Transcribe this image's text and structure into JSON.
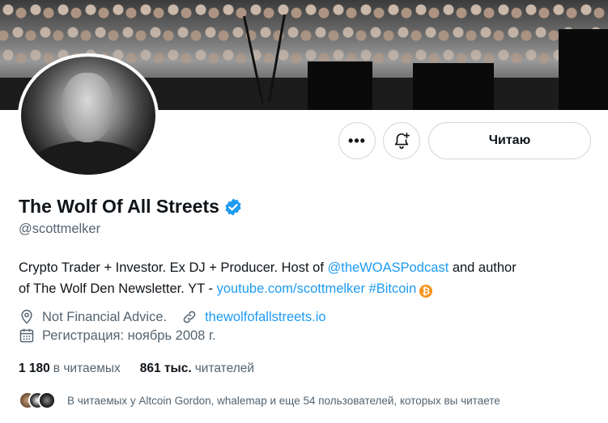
{
  "profile": {
    "name": "The Wolf Of All Streets",
    "handle": "@scottmelker",
    "follow_button_label": "Читаю",
    "verified_icon": "verified-badge-icon",
    "accent_color": "#1d9bf0"
  },
  "bio": {
    "line1_prefix": "Crypto Trader + Investor. Ex DJ + Producer. Host of ",
    "podcast_link": "@theWOASPodcast",
    "line1_suffix": " and author",
    "line2_prefix": "of The Wolf Den Newsletter. YT - ",
    "youtube_link": "youtube.com/scottmelker",
    "hashtag": "#Bitcoin",
    "emoji_icon": "bitcoin-icon"
  },
  "meta": {
    "location": "Not Financial Advice.",
    "website": "thewolfofallstreets.io",
    "joined": "Регистрация: ноябрь 2008 г."
  },
  "counts": {
    "following_num": "1 180",
    "following_label": "в читаемых",
    "followers_num": "861 тыс.",
    "followers_label": "читателей"
  },
  "followers_you_know": {
    "text": "В читаемых у Altcoin Gordon, whalemap и еще 54 пользователей, которых вы читаете"
  }
}
